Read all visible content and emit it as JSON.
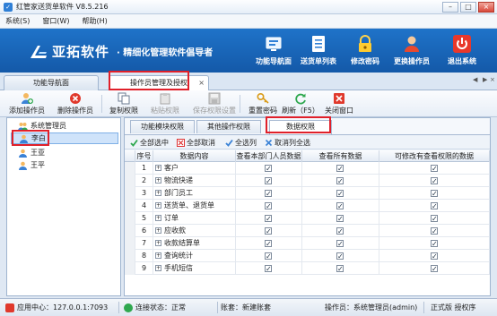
{
  "window": {
    "title": "红管家送货单软件 V8.5.216"
  },
  "menu": [
    "系统(S)",
    "窗口(W)",
    "帮助(H)"
  ],
  "banner": {
    "logo_text": "亚拓软件",
    "slogan": "· 精细化管理软件倡导者",
    "buttons": [
      {
        "label": "功能导航面",
        "icon": "nav-panel-icon"
      },
      {
        "label": "送货单列表",
        "icon": "list-icon"
      },
      {
        "label": "修改密码",
        "icon": "lock-icon"
      },
      {
        "label": "更换操作员",
        "icon": "user-switch-icon"
      },
      {
        "label": "退出系统",
        "icon": "power-icon"
      }
    ]
  },
  "doc_tabs": [
    {
      "label": "功能导航面"
    },
    {
      "label": "操作员管理及授权",
      "close": "×"
    }
  ],
  "toolbar": [
    {
      "label": "添加操作员",
      "icon": "add-user-icon",
      "enabled": true
    },
    {
      "label": "删除操作员",
      "icon": "delete-user-icon",
      "enabled": true
    },
    {
      "label": "复制权限",
      "icon": "copy-icon",
      "enabled": true
    },
    {
      "label": "粘贴权限",
      "icon": "paste-icon",
      "enabled": false
    },
    {
      "label": "保存权限设置",
      "icon": "save-icon",
      "enabled": false
    },
    {
      "label": "重置密码",
      "icon": "reset-key-icon",
      "enabled": true
    },
    {
      "label": "刷新（F5）",
      "icon": "refresh-icon",
      "enabled": true
    },
    {
      "label": "关闭窗口",
      "icon": "close-window-icon",
      "enabled": true
    }
  ],
  "tree": [
    {
      "label": "系统管理员"
    },
    {
      "label": "李白",
      "selected": true
    },
    {
      "label": "王亚"
    },
    {
      "label": "王平"
    }
  ],
  "sub_tabs": [
    "功能模块权限",
    "其他操作权限",
    "数据权限"
  ],
  "sub_toolbar": [
    {
      "label": "全部选中",
      "icon": "check-all-icon"
    },
    {
      "label": "全部取消",
      "icon": "uncheck-all-icon"
    },
    {
      "label": "全选列",
      "icon": "select-column-icon"
    },
    {
      "label": "取消列全选",
      "icon": "clear-column-icon"
    }
  ],
  "grid": {
    "columns": [
      "序号",
      "数据内容",
      "查看本部门人员数据",
      "查看所有数据",
      "可修改有查看权限的数据"
    ],
    "rows": [
      {
        "no": "1",
        "content": "客户",
        "dept": true,
        "all": true,
        "edit": true
      },
      {
        "no": "2",
        "content": "物流快递",
        "dept": true,
        "all": true,
        "edit": true
      },
      {
        "no": "3",
        "content": "部门员工",
        "dept": true,
        "all": true,
        "edit": true
      },
      {
        "no": "4",
        "content": "送货单、退货单",
        "dept": true,
        "all": true,
        "edit": true
      },
      {
        "no": "5",
        "content": "订单",
        "dept": true,
        "all": true,
        "edit": true
      },
      {
        "no": "6",
        "content": "应收款",
        "dept": true,
        "all": true,
        "edit": true
      },
      {
        "no": "7",
        "content": "收款结算单",
        "dept": true,
        "all": true,
        "edit": true
      },
      {
        "no": "8",
        "content": "查询统计",
        "dept": true,
        "all": true,
        "edit": true
      },
      {
        "no": "9",
        "content": "手机短信",
        "dept": true,
        "all": true,
        "edit": true
      }
    ]
  },
  "status": {
    "app_center": "应用中心：127.0.0.1:7093",
    "connection": "连接状态：正常",
    "account": "账套：新建账套",
    "operator": "操作员：系统管理员(admin)",
    "edition": "正式版 授权序",
    "colors": {
      "accent": "#1f73c9",
      "highlight": "#e0202a",
      "ok": "#2fa84f"
    }
  }
}
